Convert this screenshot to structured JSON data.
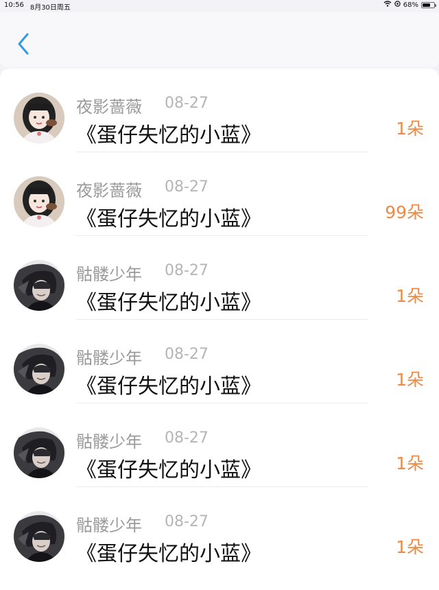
{
  "status_bar": {
    "time": "10:56",
    "date": "8月30日周五",
    "battery_percent": "68%",
    "battery_level": 0.68
  },
  "nav": {
    "back_icon": "chevron-left-icon",
    "accent_color": "#2f9be6"
  },
  "colors": {
    "amount": "#ed8a47",
    "name": "#9a9a9a",
    "date": "#b5b5b5",
    "title": "#111111"
  },
  "rows": [
    {
      "avatar": "girl-avatar",
      "name": "夜影蔷薇",
      "date": "08-27",
      "title": "《蛋仔失忆的小蓝》",
      "amount": "1朵"
    },
    {
      "avatar": "girl-avatar",
      "name": "夜影蔷薇",
      "date": "08-27",
      "title": "《蛋仔失忆的小蓝》",
      "amount": "99朵"
    },
    {
      "avatar": "dark-boy-avatar",
      "name": "骷髅少年",
      "date": "08-27",
      "title": "《蛋仔失忆的小蓝》",
      "amount": "1朵"
    },
    {
      "avatar": "dark-boy-avatar",
      "name": "骷髅少年",
      "date": "08-27",
      "title": "《蛋仔失忆的小蓝》",
      "amount": "1朵"
    },
    {
      "avatar": "dark-boy-avatar",
      "name": "骷髅少年",
      "date": "08-27",
      "title": "《蛋仔失忆的小蓝》",
      "amount": "1朵"
    },
    {
      "avatar": "dark-boy-avatar",
      "name": "骷髅少年",
      "date": "08-27",
      "title": "《蛋仔失忆的小蓝》",
      "amount": "1朵"
    }
  ]
}
